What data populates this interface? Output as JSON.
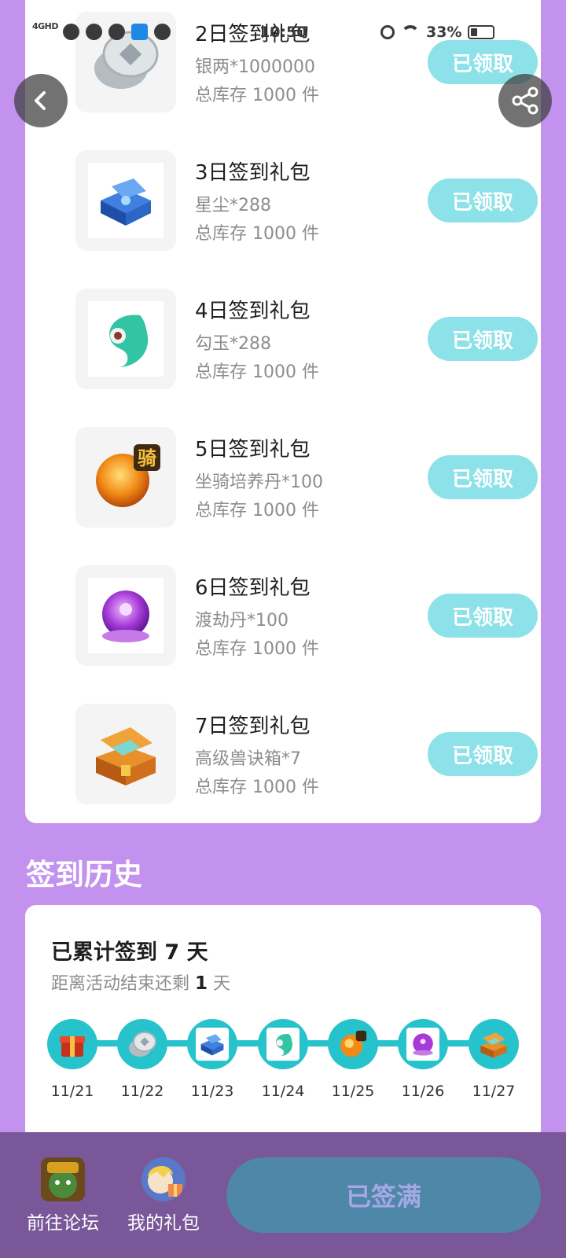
{
  "status_bar": {
    "network": "4GHD",
    "time": "10:50",
    "battery": "33%"
  },
  "gifts": [
    {
      "title": "2日签到礼包",
      "desc": "银两*1000000",
      "stock": "总库存 1000 件",
      "button": "已领取",
      "icon": "silver-coin-icon"
    },
    {
      "title": "3日签到礼包",
      "desc": "星尘*288",
      "stock": "总库存 1000 件",
      "button": "已领取",
      "icon": "blue-chest-icon"
    },
    {
      "title": "4日签到礼包",
      "desc": "勾玉*288",
      "stock": "总库存 1000 件",
      "button": "已领取",
      "icon": "jade-magatama-icon"
    },
    {
      "title": "5日签到礼包",
      "desc": "坐骑培养丹*100",
      "stock": "总库存 1000 件",
      "button": "已领取",
      "icon": "mount-pill-icon"
    },
    {
      "title": "6日签到礼包",
      "desc": "渡劫丹*100",
      "stock": "总库存 1000 件",
      "button": "已领取",
      "icon": "purple-pill-icon"
    },
    {
      "title": "7日签到礼包",
      "desc": "高级兽诀箱*7",
      "stock": "总库存 1000 件",
      "button": "已领取",
      "icon": "orange-chest-icon"
    }
  ],
  "history": {
    "section_title": "签到历史",
    "total_text": "已累计签到 7 天",
    "remain_prefix": "距离活动结束还剩",
    "remain_days": "1",
    "remain_suffix": "天",
    "dates": [
      "11/21",
      "11/22",
      "11/23",
      "11/24",
      "11/25",
      "11/26",
      "11/27"
    ]
  },
  "bottom": {
    "forum_label": "前往论坛",
    "gifts_label": "我的礼包",
    "main_button": "已签满"
  },
  "mount_badge": "骑",
  "colors": {
    "background": "#c392ef",
    "claim_button": "#8ce2e8",
    "timeline": "#26c3cc",
    "bottom_bar": "#7a5798",
    "main_button": "#4e87a8"
  }
}
